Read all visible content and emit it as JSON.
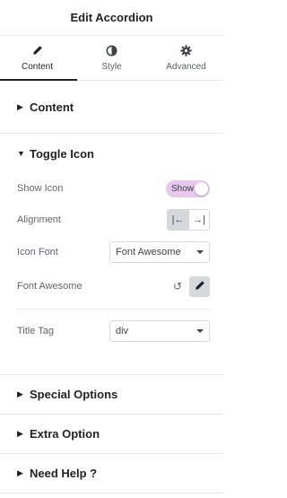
{
  "header": {
    "title": "Edit Accordion"
  },
  "tabs": [
    {
      "label": "Content",
      "icon": "pencil-icon",
      "active": true
    },
    {
      "label": "Style",
      "icon": "half-circle-icon",
      "active": false
    },
    {
      "label": "Advanced",
      "icon": "gear-icon",
      "active": false
    }
  ],
  "sections": {
    "content": {
      "label": "Content"
    },
    "toggle_icon": {
      "label": "Toggle Icon",
      "show_icon": {
        "label": "Show Icon",
        "toggle_text": "Show"
      },
      "alignment": {
        "label": "Alignment",
        "left_glyph": "|←",
        "right_glyph": "→|"
      },
      "icon_font": {
        "label": "Icon Font",
        "value": "Font Awesome"
      },
      "font_awesome": {
        "label": "Font Awesome",
        "reset_glyph": "↺"
      },
      "title_tag": {
        "label": "Title Tag",
        "value": "div"
      }
    },
    "special_options": {
      "label": "Special Options"
    },
    "extra_option": {
      "label": "Extra Option"
    },
    "need_help": {
      "label": "Need Help ?"
    }
  },
  "colors": {
    "accent_toggle": "#e9c8ee",
    "text_dark": "#1f2124",
    "border": "#e6e8ea"
  }
}
